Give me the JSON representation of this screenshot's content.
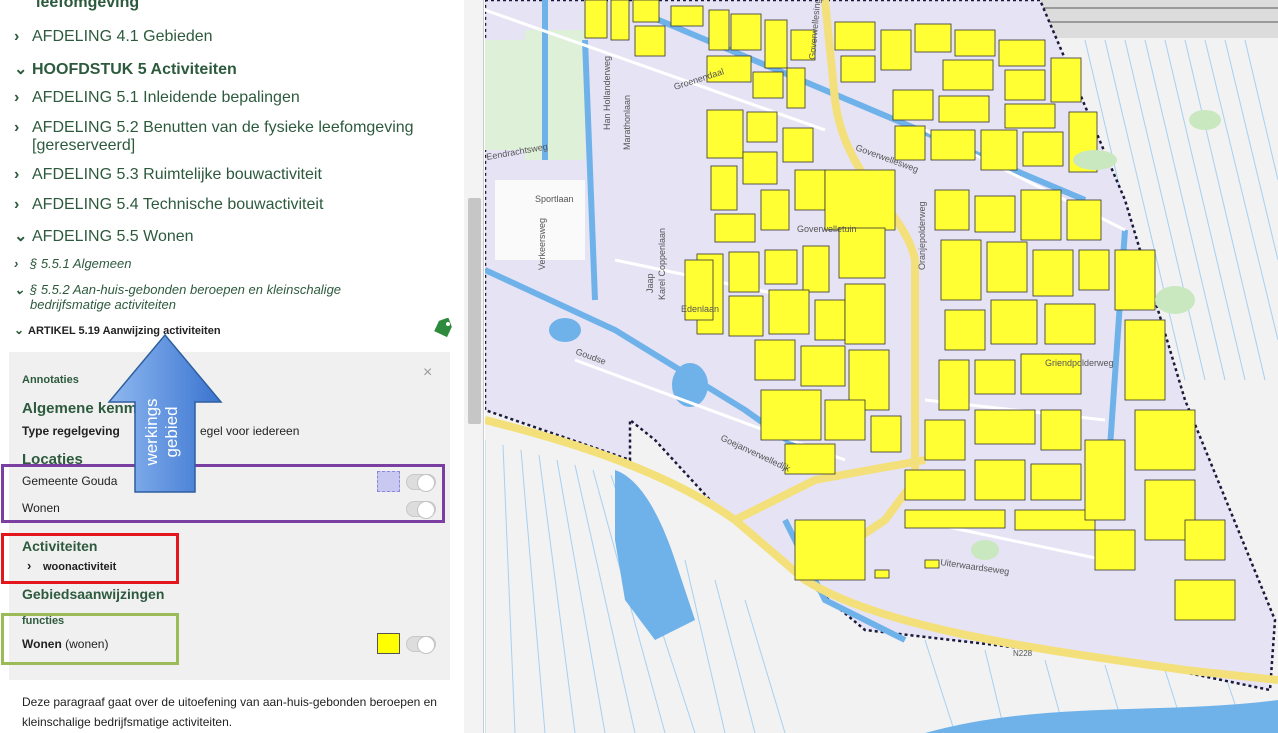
{
  "sidebar": {
    "items": [
      {
        "label": "leefomgeving"
      },
      {
        "label": "AFDELING 4.1 Gebieden"
      },
      {
        "label": "HOOFDSTUK 5 Activiteiten"
      },
      {
        "label": "AFDELING 5.1 Inleidende bepalingen"
      },
      {
        "label": "AFDELING 5.2 Benutten van de fysieke leefomgeving"
      },
      {
        "label": "[gereserveerd]"
      },
      {
        "label": "AFDELING 5.3 Ruimtelijke bouwactiviteit"
      },
      {
        "label": "AFDELING 5.4 Technische bouwactiviteit"
      },
      {
        "label": "AFDELING 5.5 Wonen"
      },
      {
        "label": "§ 5.5.1 Algemeen"
      },
      {
        "label": "§ 5.5.2 Aan-huis-gebonden beroepen en kleinschalige"
      },
      {
        "label": "bedrijfsmatige activiteiten"
      },
      {
        "label": "ARTIKEL 5.19 Aanwijzing activiteiten"
      }
    ]
  },
  "annotations": {
    "title": "Annotaties",
    "close": "×",
    "general_heading": "Algemene kenm",
    "type_label": "Type regelgeving",
    "type_value": "egel voor iedereen",
    "locations_heading": "Locaties",
    "locations": [
      {
        "label": "Gemeente Gouda",
        "swatch": "#c8c8f0"
      },
      {
        "label": "Wonen"
      }
    ],
    "activities_heading": "Activiteiten",
    "activity_item": "woonactiviteit",
    "areas_heading": "Gebiedsaanwijzingen",
    "functions_label": "functies",
    "function_item": "Wonen",
    "function_item_suffix": " (wonen)",
    "function_swatch": "#ffff00"
  },
  "callout": {
    "line1": "werkings",
    "line2": "gebied",
    "color": "#4a82d6"
  },
  "highlight_colors": {
    "locations": "#7a3fa0",
    "activities": "#e3161b",
    "functions": "#9bbb59"
  },
  "paragraph": {
    "line1": "Deze paragraaf gaat over de uitoefening van aan-huis-gebonden beroepen en",
    "line2": "kleinschalige bedrijfsmatige activiteiten."
  },
  "map": {
    "labels": [
      {
        "text": "Sportlaan"
      },
      {
        "text": "Eendrachtsweg"
      },
      {
        "text": "Han Hollanderweg"
      },
      {
        "text": "Marathonlaan"
      },
      {
        "text": "Verkeersweg"
      },
      {
        "text": "Karel Coppenlaan"
      },
      {
        "text": "Edenlaan"
      },
      {
        "text": "Jaap"
      },
      {
        "text": "Goverwelletuin"
      },
      {
        "text": "Goverwellesingel"
      },
      {
        "text": "Oranjepolderweg"
      },
      {
        "text": "Groenendaal"
      },
      {
        "text": "Goejanverwelledijk"
      },
      {
        "text": "Uiterwaardseweg"
      },
      {
        "text": "Griendpolderweg"
      },
      {
        "text": "Goverwellesweg"
      },
      {
        "text": "Goudse"
      },
      {
        "text": "N228"
      }
    ]
  }
}
